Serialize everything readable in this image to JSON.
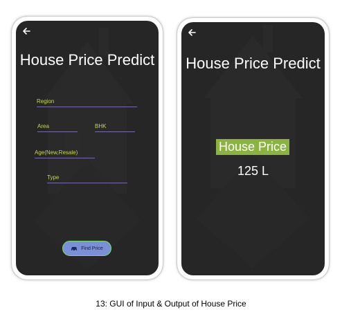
{
  "input_screen": {
    "title": "House Price Predict",
    "fields": {
      "region": "Region",
      "area": "Area",
      "bhk": "BHK",
      "age": "Age(New,Resale)",
      "type": "Type"
    },
    "find_button_label": "Find Price",
    "find_button_icon": "car-icon"
  },
  "output_screen": {
    "title": "House Price Predict",
    "result_label": "House Price",
    "result_value": "125 L"
  },
  "caption": "13: GUI of Input & Output of House Price",
  "colors": {
    "screen_bg": "#262626",
    "label_text": "#c8d84a",
    "underline": "#7a6ba8",
    "button_bg": "#7b8ed8",
    "result_highlight": "#8ab43f"
  }
}
